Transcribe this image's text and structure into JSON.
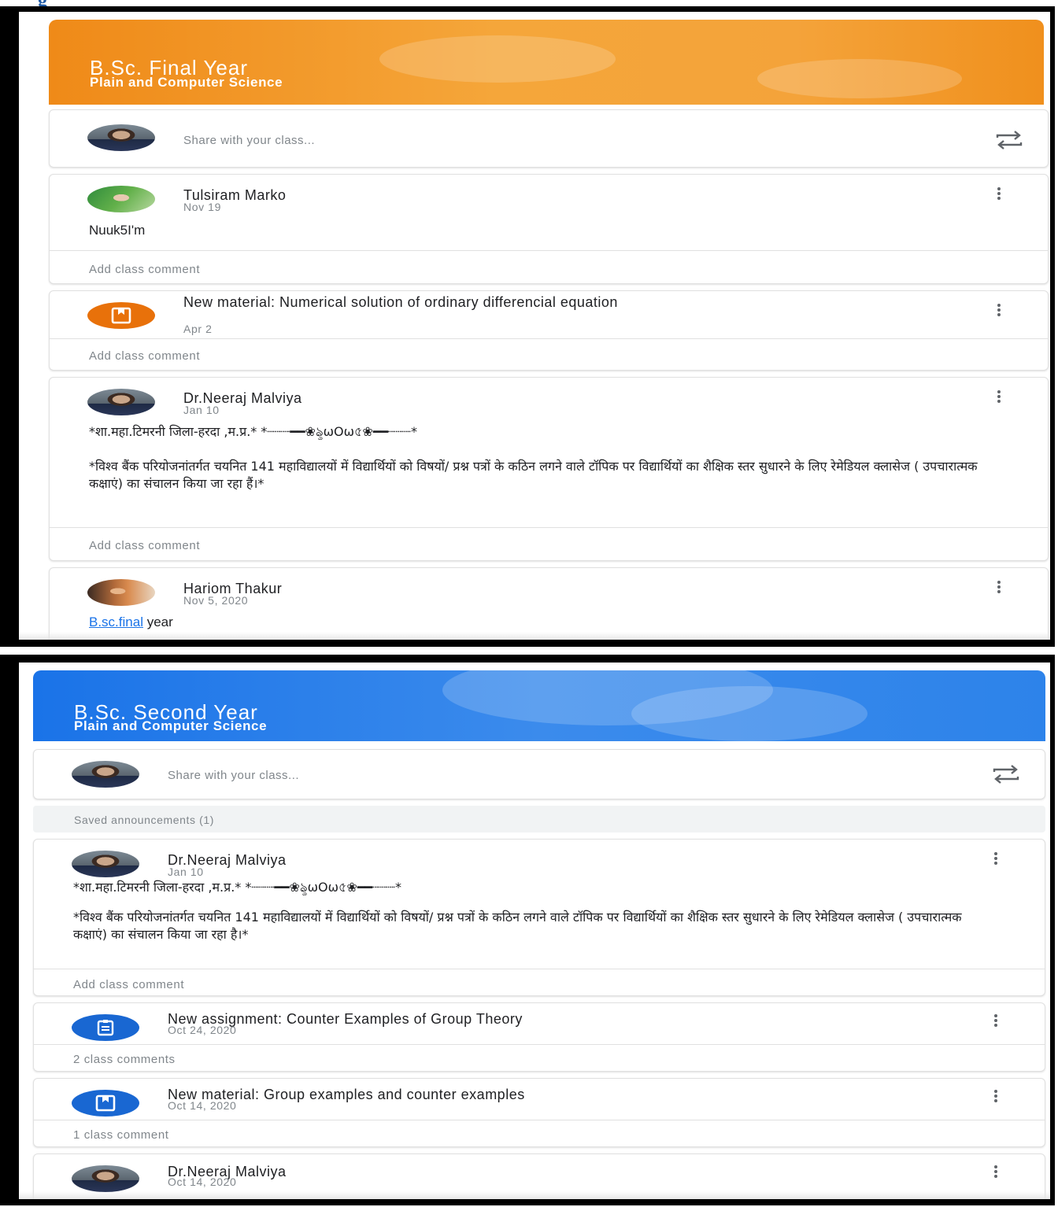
{
  "top_fragment": "g",
  "screens": [
    {
      "class_title": "B.Sc. Final Year",
      "class_subtitle": "Plain and Computer Science",
      "banner_color": "#f0901d",
      "share_placeholder": "Share with your class...",
      "posts": [
        {
          "author": "Tulsiram Marko",
          "date": "Nov 19",
          "body": "Nuuk5I'm",
          "comment": "Add class comment"
        },
        {
          "title": "New material: Numerical solution of ordinary differencial equation",
          "date": "Apr 2",
          "comment": "Add class comment"
        },
        {
          "author": "Dr.Neeraj Malviya",
          "date": "Jan 10",
          "line1": "*शा.महा.टिमरनी जिला-हरदा ,म.प्र.* *┈┈┈━━❀ৡωOω৫❀━━┈┈┈*",
          "line2": "*विश्व बैंक परियोजनांतर्गत चयनित 141 महाविद्यालयों में विद्यार्थियों को विषयों/ प्रश्न पत्रों के कठिन लगने वाले टॉपिक पर विद्यार्थियों का शैक्षिक स्तर सुधारने के लिए रेमेडियल क्लासेज ( उपचारात्मक कक्षाएं) का संचालन किया जा रहा हैं।*",
          "comment": "Add class comment"
        },
        {
          "author": "Hariom Thakur",
          "date": "Nov 5, 2020",
          "link_text": "B.sc.final",
          "body_rest": " year"
        }
      ]
    },
    {
      "class_title": "B.Sc. Second  Year",
      "class_subtitle": "Plain and Computer Science",
      "banner_color": "#1a73e8",
      "share_placeholder": "Share with your class...",
      "saved_announcements": "Saved announcements (1)",
      "posts": [
        {
          "author": "Dr.Neeraj Malviya",
          "date": "Jan 10",
          "line1": "*शा.महा.टिमरनी जिला-हरदा ,म.प्र.* *┈┈┈━━❀ৡωOω৫❀━━┈┈┈*",
          "line2": "*विश्व बैंक परियोजनांतर्गत चयनित 141 महाविद्यालयों में विद्यार्थियों को विषयों/ प्रश्न पत्रों के कठिन लगने वाले टॉपिक पर विद्यार्थियों का शैक्षिक स्तर सुधारने के लिए रेमेडियल क्लासेज ( उपचारात्मक कक्षाएं) का संचालन किया जा रहा है।*",
          "comment": "Add class comment"
        },
        {
          "title": "New assignment: Counter Examples of Group Theory",
          "date": "Oct 24, 2020",
          "comment": "2 class comments"
        },
        {
          "title": "New material: Group examples and counter examples",
          "date": "Oct 14, 2020",
          "comment": "1 class comment"
        },
        {
          "author": "Dr.Neeraj Malviya",
          "date": "Oct 14, 2020"
        }
      ]
    }
  ],
  "icons": {
    "repost": "repost-icon",
    "menu": "more-vert-icon",
    "material": "material-icon",
    "assignment": "assignment-icon"
  }
}
